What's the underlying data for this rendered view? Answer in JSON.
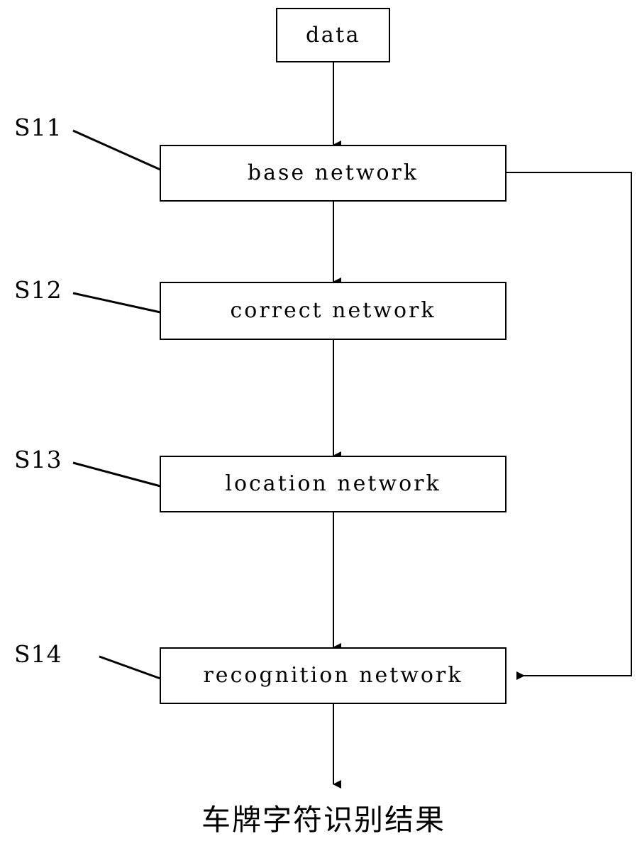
{
  "diagram": {
    "title_text": "",
    "stroke_color": "#000000",
    "background_color": "#ffffff",
    "nodes": [
      {
        "id": "data",
        "label": "data"
      },
      {
        "id": "base",
        "label": "base network"
      },
      {
        "id": "correct",
        "label": "correct network"
      },
      {
        "id": "location",
        "label": "location network"
      },
      {
        "id": "recognition",
        "label": "recognition network"
      }
    ],
    "step_labels": [
      {
        "id": "s11",
        "label": "S11"
      },
      {
        "id": "s12",
        "label": "S12"
      },
      {
        "id": "s13",
        "label": "S13"
      },
      {
        "id": "s14",
        "label": "S14"
      }
    ],
    "terminal": {
      "label": "车牌字符识别结果"
    }
  }
}
